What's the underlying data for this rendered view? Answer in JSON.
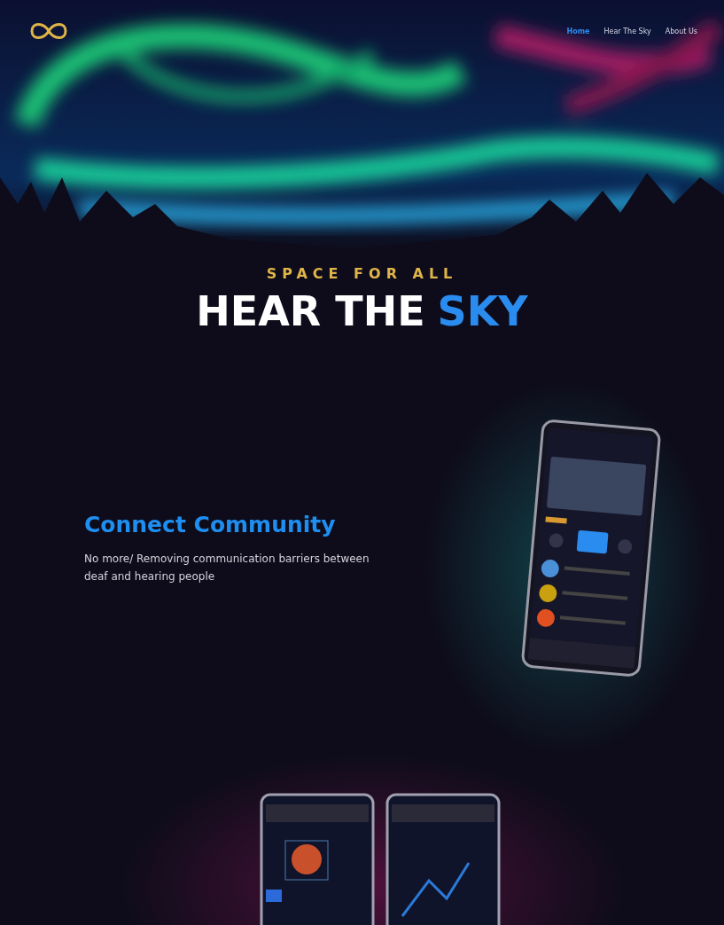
{
  "header": {
    "nav": [
      {
        "label": "Home",
        "selected": true
      },
      {
        "label": "Hear The Sky",
        "selected": false
      },
      {
        "label": "About Us",
        "selected": false
      }
    ]
  },
  "hero": {
    "kicker": "SPACE FOR ALL",
    "title": "HEAR THE",
    "title_accent": "SKY"
  },
  "feature": {
    "heading": "Connect Community",
    "text": "No more/ Removing communication barriers between deaf and hearing people"
  }
}
